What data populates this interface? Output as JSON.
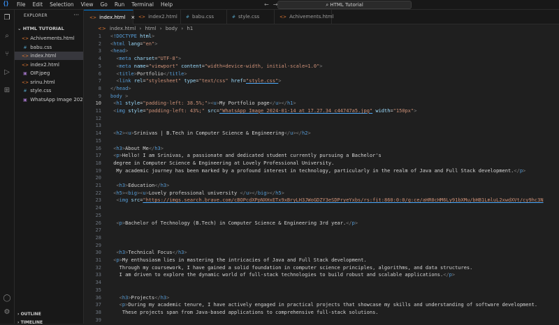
{
  "menu": [
    "File",
    "Edit",
    "Selection",
    "View",
    "Go",
    "Run",
    "Terminal",
    "Help"
  ],
  "search_label": "HTML Tutorial",
  "sidebar": {
    "title": "EXPLORER",
    "folder": "HTML TUTORIAL",
    "files": [
      {
        "name": "Achivements.html",
        "icon": "<>",
        "color": "#e37933"
      },
      {
        "name": "babu.css",
        "icon": "#",
        "color": "#519aba"
      },
      {
        "name": "index.html",
        "icon": "<>",
        "color": "#e37933",
        "active": true
      },
      {
        "name": "index2.html",
        "icon": "<>",
        "color": "#e37933"
      },
      {
        "name": "OIP.jpeg",
        "icon": "▣",
        "color": "#a074c4"
      },
      {
        "name": "srinu.html",
        "icon": "<>",
        "color": "#e37933"
      },
      {
        "name": "style.css",
        "icon": "#",
        "color": "#519aba"
      },
      {
        "name": "WhatsApp Image 202...",
        "icon": "▣",
        "color": "#a074c4"
      }
    ],
    "outline": "OUTLINE",
    "timeline": "TIMELINE"
  },
  "tabs": [
    {
      "name": "index.html",
      "icon": "<>",
      "active": true
    },
    {
      "name": "index2.html",
      "icon": "<>"
    },
    {
      "name": "babu.css",
      "icon": "#"
    },
    {
      "name": "style.css",
      "icon": "#"
    },
    {
      "name": "Achivements.html",
      "icon": "<>"
    }
  ],
  "breadcrumb": [
    "index.html",
    "html",
    "body",
    "h1"
  ],
  "code_lines": [
    {
      "n": "1",
      "html": "<span class='br'>&lt;</span><span class='tag'>!DOCTYPE</span> <span class='attr'>html</span><span class='br'>&gt;</span>"
    },
    {
      "n": "2",
      "html": "<span class='br'>&lt;</span><span class='tag'>html</span> <span class='attr'>lang</span>=<span class='str'>\"en\"</span><span class='br'>&gt;</span>"
    },
    {
      "n": "3",
      "html": "<span class='br'>&lt;</span><span class='tag'>head</span><span class='br'>&gt;</span>"
    },
    {
      "n": "4",
      "html": "  <span class='br'>&lt;</span><span class='tag'>meta</span> <span class='attr'>charset</span>=<span class='str'>\"UTF-8\"</span><span class='br'>&gt;</span>"
    },
    {
      "n": "5",
      "html": "  <span class='br'>&lt;</span><span class='tag'>meta</span> <span class='attr'>name</span>=<span class='str'>\"viewport\"</span> <span class='attr'>content</span>=<span class='str'>\"width=device-width, initial-scale=1.0\"</span><span class='br'>&gt;</span>"
    },
    {
      "n": "6",
      "html": "  <span class='br'>&lt;</span><span class='tag'>title</span><span class='br'>&gt;</span><span class='txt'>Portfolio</span><span class='br'>&lt;/</span><span class='tag'>title</span><span class='br'>&gt;</span>"
    },
    {
      "n": "7",
      "html": "  <span class='br'>&lt;</span><span class='tag'>link</span> <span class='attr'>rel</span>=<span class='str'>\"stylesheet\"</span> <span class='attr'>type</span>=<span class='str'>\"text/css\"</span> <span class='attr'>href</span>=<span class='str und'>\"style.css\"</span><span class='br'>&gt;</span>"
    },
    {
      "n": "8",
      "html": "<span class='br'>&lt;/</span><span class='tag'>head</span><span class='br'>&gt;</span>"
    },
    {
      "n": "9",
      "html": "<span class='tag'>body</span> <span class='br'>&gt;</span>"
    },
    {
      "n": "10",
      "cur": true,
      "html": " <span class='br'>&lt;</span><span class='tag'>h1</span> <span class='attr'>style</span>=<span class='str'>\"padding-left: 38.5%;\"</span><span class='br'>&gt;&lt;</span><span class='tag'>u</span><span class='br'>&gt;</span><span class='txt'>My Portfolio page</span><span class='br'>&lt;/</span><span class='tag'>u</span><span class='br'>&gt;&lt;/</span><span class='tag'>h1</span><span class='br'>&gt;</span>"
    },
    {
      "n": "11",
      "html": " <span class='br'>&lt;</span><span class='tag'>img</span> <span class='attr'>style</span>=<span class='str'>\"padding-left: 43%;\"</span> <span class='attr'>src</span>=<span class='str und'>\"WhatsApp Image 2024-01-14 at 17.27.34_c44747a5.jpg\"</span> <span class='attr'>width</span>=<span class='str'>\"150px\"</span><span class='br'>&gt;</span>"
    },
    {
      "n": "12",
      "html": ""
    },
    {
      "n": "13",
      "html": ""
    },
    {
      "n": "14",
      "html": " <span class='br'>&lt;</span><span class='tag'>h2</span><span class='br'>&gt;&lt;</span><span class='tag'>u</span><span class='br'>&gt;</span><span class='txt'>Srinivas | B.Tech in Computer Science &amp; Engineering</span><span class='br'>&lt;/</span><span class='tag'>u</span><span class='br'>&gt;&lt;/</span><span class='tag'>h2</span><span class='br'>&gt;</span>"
    },
    {
      "n": "15",
      "html": ""
    },
    {
      "n": "16",
      "html": " <span class='br'>&lt;</span><span class='tag'>h3</span><span class='br'>&gt;</span><span class='txt'>About Me</span><span class='br'>&lt;/</span><span class='tag'>h3</span><span class='br'>&gt;</span>"
    },
    {
      "n": "17",
      "html": " <span class='br'>&lt;</span><span class='tag'>p</span><span class='br'>&gt;</span><span class='txt'>Hello! I am Srinivas, a passionate and dedicated student currently pursuing a Bachelor's</span>"
    },
    {
      "n": "18",
      "html": "<span class='txt'> degree in Computer Science &amp; Engineering at Lovely Professional University.</span>"
    },
    {
      "n": "19",
      "html": "<span class='txt'>  My academic journey has been marked by a profound interest in technology, particularly in the realm of Java and Full Stack development.</span><span class='br'>&lt;/</span><span class='tag'>p</span><span class='br'>&gt;</span>"
    },
    {
      "n": "20",
      "html": ""
    },
    {
      "n": "21",
      "html": "  <span class='br'>&lt;</span><span class='tag'>h3</span><span class='br'>&gt;</span><span class='txt'>Education</span><span class='br'>&lt;/</span><span class='tag'>h3</span><span class='br'>&gt;</span>"
    },
    {
      "n": "22",
      "html": " <span class='br'>&lt;</span><span class='tag'>h5</span><span class='br'>&gt;&lt;</span><span class='tag'>big</span><span class='br'>&gt;&lt;</span><span class='tag'>u</span><span class='br'>&gt;</span><span class='txt'>Lovely professional university </span><span class='br'>&lt;/</span><span class='tag'>u</span><span class='br'>&gt;&lt;/</span><span class='tag'>big</span><span class='br'>&gt;&lt;/</span><span class='tag'>h5</span><span class='br'>&gt;</span>"
    },
    {
      "n": "23",
      "html": "  <span class='br'>&lt;</span><span class='tag'>img</span> <span class='attr'>src</span>=<span class='str und'>\"https://imgs.search.brave.com/cBOPcdXPpNXHxETx9xBryLH3JWoGDZY3eSDPryeYxbs/rs:fit:860:0:0/g:ce/aHR0cHM6Ly91bXMu/bHB1LmluL2xwdXVt/cy9hc3N</span>"
    },
    {
      "n": "24",
      "html": ""
    },
    {
      "n": "25",
      "html": ""
    },
    {
      "n": "26",
      "html": "  <span class='br'>&lt;</span><span class='tag'>p</span><span class='br'>&gt;</span><span class='txt'>Bachelor of Technology (B.Tech) in Computer Science &amp; Engineering 3rd year.</span><span class='br'>&lt;/</span><span class='tag'>p</span><span class='br'>&gt;</span>"
    },
    {
      "n": "27",
      "html": ""
    },
    {
      "n": "28",
      "html": ""
    },
    {
      "n": "29",
      "html": ""
    },
    {
      "n": "30",
      "html": "  <span class='br'>&lt;</span><span class='tag'>h3</span><span class='br'>&gt;</span><span class='txt'>Technical Focus</span><span class='br'>&lt;/</span><span class='tag'>h3</span><span class='br'>&gt;</span>"
    },
    {
      "n": "31",
      "html": " <span class='br'>&lt;</span><span class='tag'>p</span><span class='br'>&gt;</span><span class='txt'>My enthusiasm lies in mastering the intricacies of Java and Full Stack development.</span>"
    },
    {
      "n": "32",
      "html": "<span class='txt'>   Through my coursework, I have gained a solid foundation in computer science principles, algorithms, and data structures.</span>"
    },
    {
      "n": "33",
      "html": "<span class='txt'>   I am driven to explore the dynamic world of full-stack technologies to build robust and scalable applications.</span><span class='br'>&lt;/</span><span class='tag'>p</span><span class='br'>&gt;</span>"
    },
    {
      "n": "34",
      "html": ""
    },
    {
      "n": "35",
      "html": ""
    },
    {
      "n": "36",
      "html": "   <span class='br'>&lt;</span><span class='tag'>h3</span><span class='br'>&gt;</span><span class='txt'>Projects</span><span class='br'>&lt;/</span><span class='tag'>h3</span><span class='br'>&gt;</span>"
    },
    {
      "n": "37",
      "html": "   <span class='br'>&lt;</span><span class='tag'>p</span><span class='br'>&gt;</span><span class='txt'>During my academic tenure, I have actively engaged in practical projects that showcase my skills and understanding of software development.</span>"
    },
    {
      "n": "38",
      "html": "<span class='txt'>    These projects span from Java-based applications to comprehensive full-stack solutions.</span>"
    },
    {
      "n": "39",
      "html": ""
    }
  ]
}
